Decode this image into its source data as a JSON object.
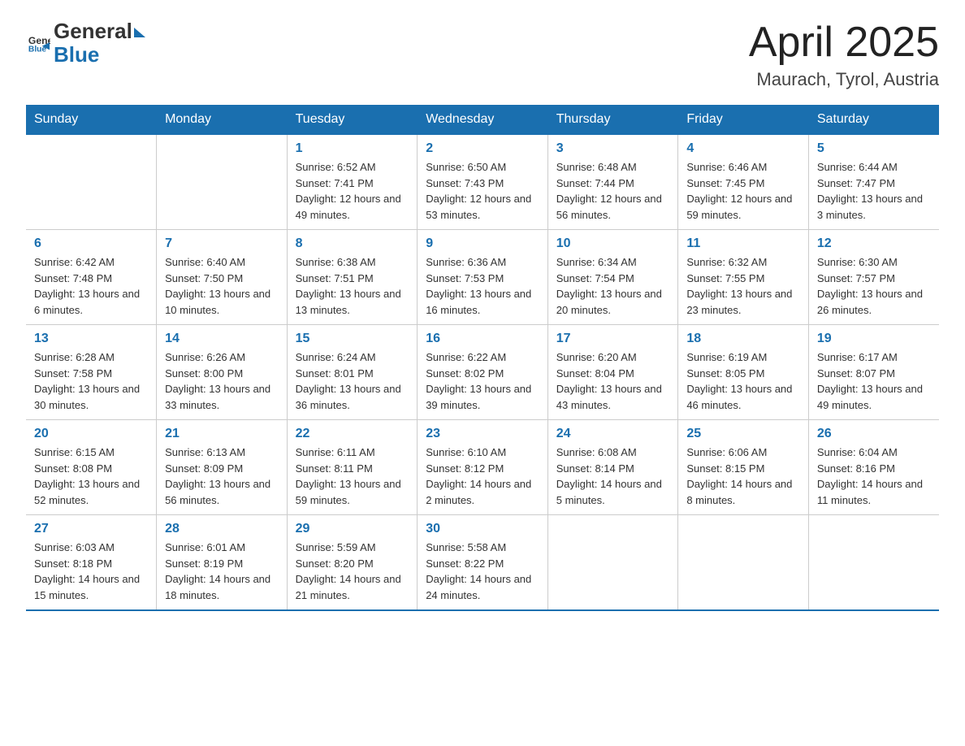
{
  "logo": {
    "general": "General",
    "blue": "Blue"
  },
  "header": {
    "title": "April 2025",
    "subtitle": "Maurach, Tyrol, Austria"
  },
  "weekdays": [
    "Sunday",
    "Monday",
    "Tuesday",
    "Wednesday",
    "Thursday",
    "Friday",
    "Saturday"
  ],
  "weeks": [
    [
      {
        "day": "",
        "sunrise": "",
        "sunset": "",
        "daylight": ""
      },
      {
        "day": "",
        "sunrise": "",
        "sunset": "",
        "daylight": ""
      },
      {
        "day": "1",
        "sunrise": "Sunrise: 6:52 AM",
        "sunset": "Sunset: 7:41 PM",
        "daylight": "Daylight: 12 hours and 49 minutes."
      },
      {
        "day": "2",
        "sunrise": "Sunrise: 6:50 AM",
        "sunset": "Sunset: 7:43 PM",
        "daylight": "Daylight: 12 hours and 53 minutes."
      },
      {
        "day": "3",
        "sunrise": "Sunrise: 6:48 AM",
        "sunset": "Sunset: 7:44 PM",
        "daylight": "Daylight: 12 hours and 56 minutes."
      },
      {
        "day": "4",
        "sunrise": "Sunrise: 6:46 AM",
        "sunset": "Sunset: 7:45 PM",
        "daylight": "Daylight: 12 hours and 59 minutes."
      },
      {
        "day": "5",
        "sunrise": "Sunrise: 6:44 AM",
        "sunset": "Sunset: 7:47 PM",
        "daylight": "Daylight: 13 hours and 3 minutes."
      }
    ],
    [
      {
        "day": "6",
        "sunrise": "Sunrise: 6:42 AM",
        "sunset": "Sunset: 7:48 PM",
        "daylight": "Daylight: 13 hours and 6 minutes."
      },
      {
        "day": "7",
        "sunrise": "Sunrise: 6:40 AM",
        "sunset": "Sunset: 7:50 PM",
        "daylight": "Daylight: 13 hours and 10 minutes."
      },
      {
        "day": "8",
        "sunrise": "Sunrise: 6:38 AM",
        "sunset": "Sunset: 7:51 PM",
        "daylight": "Daylight: 13 hours and 13 minutes."
      },
      {
        "day": "9",
        "sunrise": "Sunrise: 6:36 AM",
        "sunset": "Sunset: 7:53 PM",
        "daylight": "Daylight: 13 hours and 16 minutes."
      },
      {
        "day": "10",
        "sunrise": "Sunrise: 6:34 AM",
        "sunset": "Sunset: 7:54 PM",
        "daylight": "Daylight: 13 hours and 20 minutes."
      },
      {
        "day": "11",
        "sunrise": "Sunrise: 6:32 AM",
        "sunset": "Sunset: 7:55 PM",
        "daylight": "Daylight: 13 hours and 23 minutes."
      },
      {
        "day": "12",
        "sunrise": "Sunrise: 6:30 AM",
        "sunset": "Sunset: 7:57 PM",
        "daylight": "Daylight: 13 hours and 26 minutes."
      }
    ],
    [
      {
        "day": "13",
        "sunrise": "Sunrise: 6:28 AM",
        "sunset": "Sunset: 7:58 PM",
        "daylight": "Daylight: 13 hours and 30 minutes."
      },
      {
        "day": "14",
        "sunrise": "Sunrise: 6:26 AM",
        "sunset": "Sunset: 8:00 PM",
        "daylight": "Daylight: 13 hours and 33 minutes."
      },
      {
        "day": "15",
        "sunrise": "Sunrise: 6:24 AM",
        "sunset": "Sunset: 8:01 PM",
        "daylight": "Daylight: 13 hours and 36 minutes."
      },
      {
        "day": "16",
        "sunrise": "Sunrise: 6:22 AM",
        "sunset": "Sunset: 8:02 PM",
        "daylight": "Daylight: 13 hours and 39 minutes."
      },
      {
        "day": "17",
        "sunrise": "Sunrise: 6:20 AM",
        "sunset": "Sunset: 8:04 PM",
        "daylight": "Daylight: 13 hours and 43 minutes."
      },
      {
        "day": "18",
        "sunrise": "Sunrise: 6:19 AM",
        "sunset": "Sunset: 8:05 PM",
        "daylight": "Daylight: 13 hours and 46 minutes."
      },
      {
        "day": "19",
        "sunrise": "Sunrise: 6:17 AM",
        "sunset": "Sunset: 8:07 PM",
        "daylight": "Daylight: 13 hours and 49 minutes."
      }
    ],
    [
      {
        "day": "20",
        "sunrise": "Sunrise: 6:15 AM",
        "sunset": "Sunset: 8:08 PM",
        "daylight": "Daylight: 13 hours and 52 minutes."
      },
      {
        "day": "21",
        "sunrise": "Sunrise: 6:13 AM",
        "sunset": "Sunset: 8:09 PM",
        "daylight": "Daylight: 13 hours and 56 minutes."
      },
      {
        "day": "22",
        "sunrise": "Sunrise: 6:11 AM",
        "sunset": "Sunset: 8:11 PM",
        "daylight": "Daylight: 13 hours and 59 minutes."
      },
      {
        "day": "23",
        "sunrise": "Sunrise: 6:10 AM",
        "sunset": "Sunset: 8:12 PM",
        "daylight": "Daylight: 14 hours and 2 minutes."
      },
      {
        "day": "24",
        "sunrise": "Sunrise: 6:08 AM",
        "sunset": "Sunset: 8:14 PM",
        "daylight": "Daylight: 14 hours and 5 minutes."
      },
      {
        "day": "25",
        "sunrise": "Sunrise: 6:06 AM",
        "sunset": "Sunset: 8:15 PM",
        "daylight": "Daylight: 14 hours and 8 minutes."
      },
      {
        "day": "26",
        "sunrise": "Sunrise: 6:04 AM",
        "sunset": "Sunset: 8:16 PM",
        "daylight": "Daylight: 14 hours and 11 minutes."
      }
    ],
    [
      {
        "day": "27",
        "sunrise": "Sunrise: 6:03 AM",
        "sunset": "Sunset: 8:18 PM",
        "daylight": "Daylight: 14 hours and 15 minutes."
      },
      {
        "day": "28",
        "sunrise": "Sunrise: 6:01 AM",
        "sunset": "Sunset: 8:19 PM",
        "daylight": "Daylight: 14 hours and 18 minutes."
      },
      {
        "day": "29",
        "sunrise": "Sunrise: 5:59 AM",
        "sunset": "Sunset: 8:20 PM",
        "daylight": "Daylight: 14 hours and 21 minutes."
      },
      {
        "day": "30",
        "sunrise": "Sunrise: 5:58 AM",
        "sunset": "Sunset: 8:22 PM",
        "daylight": "Daylight: 14 hours and 24 minutes."
      },
      {
        "day": "",
        "sunrise": "",
        "sunset": "",
        "daylight": ""
      },
      {
        "day": "",
        "sunrise": "",
        "sunset": "",
        "daylight": ""
      },
      {
        "day": "",
        "sunrise": "",
        "sunset": "",
        "daylight": ""
      }
    ]
  ]
}
